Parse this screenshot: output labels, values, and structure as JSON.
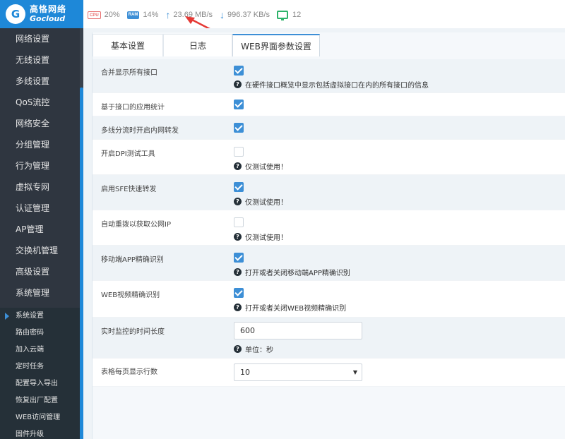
{
  "brand": {
    "logo_mark": "G",
    "name_cn": "高恪网络",
    "name_en": "Gocloud"
  },
  "stats": {
    "cpu_chip": "CPU",
    "cpu": "20%",
    "ram_chip": "RAM",
    "ram": "14%",
    "upload_icon": "up-arrow-icon",
    "upload": "23.69 MB/s",
    "download_icon": "down-arrow-icon",
    "download": "996.37 KB/s",
    "devices_icon": "monitor-icon",
    "devices": "12"
  },
  "sidebar": {
    "items": [
      "网络设置",
      "无线设置",
      "多线设置",
      "QoS流控",
      "网络安全",
      "分组管理",
      "行为管理",
      "虚拟专网",
      "认证管理",
      "AP管理",
      "交换机管理",
      "高级设置",
      "系统管理"
    ],
    "sub_items": [
      "系统设置",
      "路由密码",
      "加入云端",
      "定时任务",
      "配置导入导出",
      "恢复出厂配置",
      "WEB访问管理",
      "固件升级"
    ],
    "active_sub": "系统设置"
  },
  "tabs": [
    "基本设置",
    "日志",
    "WEB界面参数设置"
  ],
  "active_tab": "WEB界面参数设置",
  "settings": [
    {
      "label": "合并显示所有接口",
      "checked": true,
      "hint": "在硬件接口概览中显示包括虚拟接口在内的所有接口的信息"
    },
    {
      "label": "基于接口的应用统计",
      "checked": true,
      "hint": ""
    },
    {
      "label": "多线分流时开启内网转发",
      "checked": true,
      "hint": ""
    },
    {
      "label": "开启DPI测试工具",
      "checked": false,
      "hint": "仅测试使用！"
    },
    {
      "label": "启用SFE快速转发",
      "checked": true,
      "hint": "仅测试使用！"
    },
    {
      "label": "自动重拨以获取公网IP",
      "checked": false,
      "hint": "仅测试使用！"
    },
    {
      "label": "移动端APP精确识别",
      "checked": true,
      "hint": "打开或者关闭移动端APP精确识别"
    },
    {
      "label": "WEB视频精确识别",
      "checked": true,
      "hint": "打开或者关闭WEB视频精确识别"
    }
  ],
  "monitor_duration": {
    "label": "实时监控的时间长度",
    "value": "600",
    "hint": "单位：秒"
  },
  "rows_per_page": {
    "label": "表格每页显示行数",
    "value": "10"
  },
  "colors": {
    "accent": "#3d8fd6",
    "sidebar": "#2f3640",
    "logo": "#1e88d8",
    "annotation": "#e53935"
  }
}
